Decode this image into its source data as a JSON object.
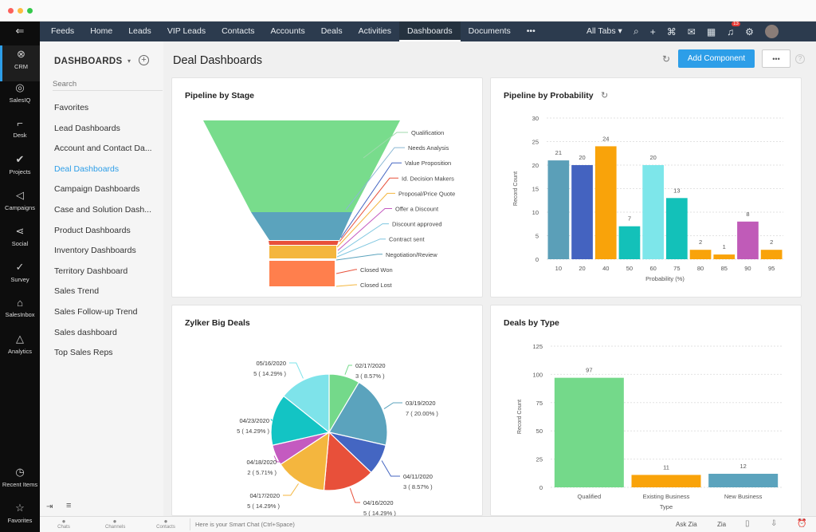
{
  "window": {
    "dots": [
      "#fc605b",
      "#fdbc40",
      "#34c84a"
    ]
  },
  "topnav": {
    "tabs": [
      "Feeds",
      "Home",
      "Leads",
      "VIP Leads",
      "Contacts",
      "Accounts",
      "Deals",
      "Activities",
      "Dashboards",
      "Documents",
      "•••"
    ],
    "active": "Dashboards",
    "all_tabs": "All Tabs ▾",
    "notification_count": "13"
  },
  "iconbar": {
    "items": [
      {
        "label": "CRM",
        "icon": "crm-icon"
      },
      {
        "label": "SalesIQ",
        "icon": "salesiq-icon"
      },
      {
        "label": "Desk",
        "icon": "desk-icon"
      },
      {
        "label": "Projects",
        "icon": "check-icon"
      },
      {
        "label": "Campaigns",
        "icon": "megaphone-icon"
      },
      {
        "label": "Social",
        "icon": "share-icon"
      },
      {
        "label": "Survey",
        "icon": "survey-icon"
      },
      {
        "label": "SalesInbox",
        "icon": "inbox-icon"
      },
      {
        "label": "Analytics",
        "icon": "analytics-icon"
      }
    ],
    "recent": "Recent Items",
    "favorites": "Favorites"
  },
  "sidebar": {
    "title": "DASHBOARDS",
    "search_placeholder": "Search",
    "items": [
      "Favorites",
      "Lead Dashboards",
      "Account and Contact Da...",
      "Deal Dashboards",
      "Campaign Dashboards",
      "Case and Solution Dash...",
      "Product Dashboards",
      "Inventory Dashboards",
      "Territory Dashboard",
      "Sales Trend",
      "Sales Follow-up Trend",
      "Sales dashboard",
      "Top Sales Reps"
    ],
    "active": "Deal Dashboards"
  },
  "header": {
    "title": "Deal Dashboards",
    "add_component": "Add Component",
    "more": "•••",
    "help": "?"
  },
  "colors": {
    "accent": "#2d9ee8",
    "nav": "#2c3b4e"
  },
  "bottombar": {
    "items": [
      "Chats",
      "Channels",
      "Contacts"
    ],
    "smart_chat_placeholder": "Here is your Smart Chat (Ctrl+Space)",
    "ask_zia": "Ask Zia",
    "zia": "Zia"
  },
  "chart_data": [
    {
      "type": "funnel",
      "title": "Pipeline by Stage",
      "stages": [
        "Qualification",
        "Needs Analysis",
        "Value Proposition",
        "Id. Decision Makers",
        "Proposal/Price Quote",
        "Offer a Discount",
        "Discount approved",
        "Contract sent",
        "Negotiation/Review",
        "Closed Won",
        "Closed Lost"
      ]
    },
    {
      "type": "bar",
      "title": "Pipeline by Probability",
      "xlabel": "Probability (%)",
      "ylabel": "Record Count",
      "ylim": [
        0,
        30
      ],
      "yticks": [
        0,
        5,
        10,
        15,
        20,
        25,
        30
      ],
      "categories": [
        "10",
        "20",
        "40",
        "50",
        "60",
        "75",
        "80",
        "85",
        "90",
        "95"
      ],
      "values": [
        21,
        20,
        24,
        7,
        20,
        13,
        2,
        1,
        8,
        2
      ],
      "colors": [
        "#5b9fb8",
        "#4463c0",
        "#f9a30a",
        "#13c1b9",
        "#7de6ea",
        "#13c1b9",
        "#f9a30a",
        "#f9a30a",
        "#c05bb8",
        "#f9a30a"
      ],
      "grid": true
    },
    {
      "type": "pie",
      "title": "Zylker Big Deals",
      "slices": [
        {
          "label": "02/17/2020",
          "value": 3,
          "pct": "3 ( 8.57% )",
          "color": "#74d98a"
        },
        {
          "label": "03/19/2020",
          "value": 7,
          "pct": "7 ( 20.00% )",
          "color": "#5ba3bd"
        },
        {
          "label": "04/11/2020",
          "value": 3,
          "pct": "3 ( 8.57% )",
          "color": "#4466c2"
        },
        {
          "label": "04/16/2020",
          "value": 5,
          "pct": "5 ( 14.29% )",
          "color": "#e8503a"
        },
        {
          "label": "04/17/2020",
          "value": 5,
          "pct": "5 ( 14.29% )",
          "color": "#f4b63e"
        },
        {
          "label": "04/18/2020",
          "value": 2,
          "pct": "2 ( 5.71% )",
          "color": "#c45ac0"
        },
        {
          "label": "04/23/2020",
          "value": 5,
          "pct": "5 ( 14.29% )",
          "color": "#13c4c4"
        },
        {
          "label": "05/16/2020",
          "value": 5,
          "pct": "5 ( 14.29% )",
          "color": "#7ee3ea"
        }
      ]
    },
    {
      "type": "bar",
      "title": "Deals by Type",
      "xlabel": "Type",
      "ylabel": "Record Count",
      "ylim": [
        0,
        125
      ],
      "yticks": [
        0,
        25,
        50,
        75,
        100,
        125
      ],
      "categories": [
        "Qualified",
        "Existing Business",
        "New Business"
      ],
      "values": [
        97,
        11,
        12
      ],
      "colors": [
        "#74d98a",
        "#f9a30a",
        "#5ba3bd"
      ],
      "grid": true
    }
  ]
}
